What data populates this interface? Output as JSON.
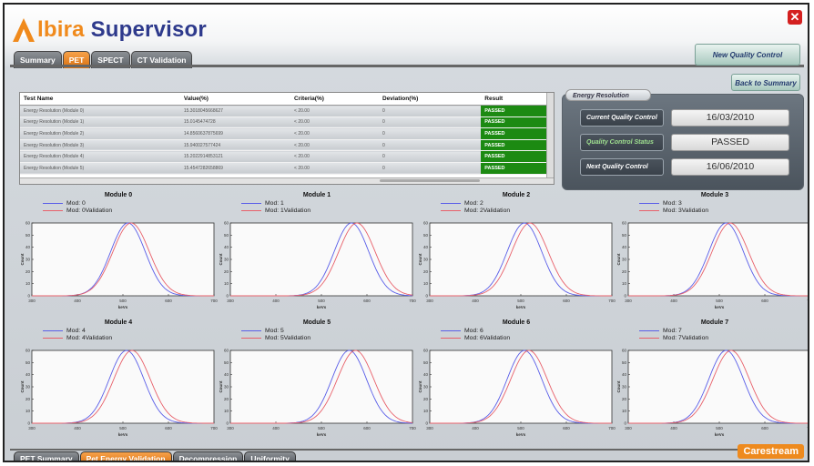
{
  "app": {
    "brand": "Albira",
    "brand_rest": "lbira",
    "product": "Supervisor"
  },
  "colors": {
    "accent": "#f08a1c",
    "title": "#2e3a8c",
    "passed": "#1c8a12",
    "series_a": "#5a5ee8",
    "series_b": "#e8606a"
  },
  "top_tabs": [
    {
      "label": "Summary"
    },
    {
      "label": "PET"
    },
    {
      "label": "SPECT"
    },
    {
      "label": "CT Validation"
    }
  ],
  "buttons": {
    "new_qc": "New Quality Control",
    "back_summary": "Back to Summary"
  },
  "table": {
    "headers": [
      "Test Name",
      "Value(%)",
      "Criteria(%)",
      "Deviation(%)",
      "Result"
    ],
    "rows": [
      [
        "Energy Resolution (Module 0)",
        "15.3018045668627",
        "< 20.00",
        "0",
        "PASSED"
      ],
      [
        "Energy Resolution (Module 1)",
        "15.0145474728",
        "< 20.00",
        "0",
        "PASSED"
      ],
      [
        "Energy Resolution (Module 2)",
        "14.8560637875699",
        "< 20.00",
        "0",
        "PASSED"
      ],
      [
        "Energy Resolution (Module 3)",
        "15.940027577424",
        "< 20.00",
        "0",
        "PASSED"
      ],
      [
        "Energy Resolution (Module 4)",
        "15.2022914853121",
        "< 20.00",
        "0",
        "PASSED"
      ],
      [
        "Energy Resolution (Module 5)",
        "15.4547282658869",
        "< 20.00",
        "0",
        "PASSED"
      ]
    ]
  },
  "energy_resolution": {
    "tab": "Energy Resolution",
    "rows": [
      {
        "label": "Current Quality Control",
        "value": "16/03/2010"
      },
      {
        "label": "Quality Control Status",
        "value": "PASSED"
      },
      {
        "label": "Next Quality Control",
        "value": "16/06/2010"
      }
    ]
  },
  "bottom_tabs": [
    {
      "label": "PET Summary"
    },
    {
      "label": "Pet Energy Validation"
    },
    {
      "label": "Decompression"
    },
    {
      "label": "Uniformity"
    }
  ],
  "footer_brand": "Carestream",
  "chart_data": [
    {
      "type": "line",
      "title": "Module 0",
      "series": [
        {
          "name": "Mod: 0",
          "peak": 511,
          "sigma": 38
        },
        {
          "name": "Mod: 0Validation",
          "peak": 518,
          "sigma": 40
        }
      ],
      "xlabel": "keVs",
      "ylabel": "Count",
      "xlim": [
        300,
        700
      ],
      "ylim": [
        0,
        60
      ],
      "xticks": [
        300,
        400,
        500,
        600,
        700
      ],
      "yticks": [
        0,
        10,
        20,
        30,
        40,
        50,
        60
      ]
    },
    {
      "type": "line",
      "title": "Module 1",
      "series": [
        {
          "name": "Mod: 1",
          "peak": 566,
          "sigma": 38
        },
        {
          "name": "Mod: 1Validation",
          "peak": 578,
          "sigma": 40
        }
      ],
      "xlabel": "keVs",
      "ylabel": "Count",
      "xlim": [
        300,
        700
      ],
      "ylim": [
        0,
        60
      ],
      "xticks": [
        300,
        400,
        500,
        600,
        700
      ],
      "yticks": [
        0,
        10,
        20,
        30,
        40,
        50,
        60
      ]
    },
    {
      "type": "line",
      "title": "Module 2",
      "series": [
        {
          "name": "Mod: 2",
          "peak": 508,
          "sigma": 38
        },
        {
          "name": "Mod: 2Validation",
          "peak": 520,
          "sigma": 40
        }
      ],
      "xlabel": "keVs",
      "ylabel": "Count",
      "xlim": [
        300,
        700
      ],
      "ylim": [
        0,
        60
      ],
      "xticks": [
        300,
        400,
        500,
        600,
        700
      ],
      "yticks": [
        0,
        10,
        20,
        30,
        40,
        50,
        60
      ]
    },
    {
      "type": "line",
      "title": "Module 3",
      "series": [
        {
          "name": "Mod: 3",
          "peak": 515,
          "sigma": 38
        },
        {
          "name": "Mod: 3Validation",
          "peak": 524,
          "sigma": 40
        }
      ],
      "xlabel": "keVs",
      "ylabel": "Count",
      "xlim": [
        300,
        700
      ],
      "ylim": [
        0,
        60
      ],
      "xticks": [
        300,
        400,
        500,
        600,
        700
      ],
      "yticks": [
        0,
        10,
        20,
        30,
        40,
        50,
        60
      ]
    },
    {
      "type": "line",
      "title": "Module 4",
      "series": [
        {
          "name": "Mod: 4",
          "peak": 508,
          "sigma": 38
        },
        {
          "name": "Mod: 4Validation",
          "peak": 520,
          "sigma": 40
        }
      ],
      "xlabel": "keVs",
      "ylabel": "Count",
      "xlim": [
        300,
        700
      ],
      "ylim": [
        0,
        60
      ],
      "xticks": [
        300,
        400,
        500,
        600,
        700
      ],
      "yticks": [
        0,
        10,
        20,
        30,
        40,
        50,
        60
      ]
    },
    {
      "type": "line",
      "title": "Module 5",
      "series": [
        {
          "name": "Mod: 5",
          "peak": 561,
          "sigma": 38
        },
        {
          "name": "Mod: 5Validation",
          "peak": 575,
          "sigma": 40
        }
      ],
      "xlabel": "keVs",
      "ylabel": "Count",
      "xlim": [
        300,
        700
      ],
      "ylim": [
        0,
        60
      ],
      "xticks": [
        300,
        400,
        500,
        600,
        700
      ],
      "yticks": [
        0,
        10,
        20,
        30,
        40,
        50,
        60
      ]
    },
    {
      "type": "line",
      "title": "Module 6",
      "series": [
        {
          "name": "Mod: 6",
          "peak": 508,
          "sigma": 38
        },
        {
          "name": "Mod: 6Validation",
          "peak": 518,
          "sigma": 40
        }
      ],
      "xlabel": "keVs",
      "ylabel": "Count",
      "xlim": [
        300,
        700
      ],
      "ylim": [
        0,
        60
      ],
      "xticks": [
        300,
        400,
        500,
        600,
        700
      ],
      "yticks": [
        0,
        10,
        20,
        30,
        40,
        50,
        60
      ]
    },
    {
      "type": "line",
      "title": "Module 7",
      "series": [
        {
          "name": "Mod: 7",
          "peak": 515,
          "sigma": 38
        },
        {
          "name": "Mod: 7Validation",
          "peak": 526,
          "sigma": 40
        }
      ],
      "xlabel": "keVs",
      "ylabel": "Count",
      "xlim": [
        300,
        700
      ],
      "ylim": [
        0,
        60
      ],
      "xticks": [
        300,
        400,
        500,
        600,
        700
      ],
      "yticks": [
        0,
        10,
        20,
        30,
        40,
        50,
        60
      ]
    }
  ]
}
